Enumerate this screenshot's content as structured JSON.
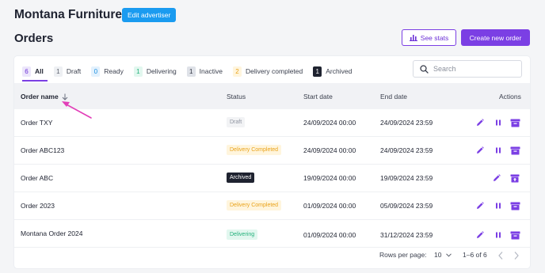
{
  "header": {
    "advertiser": "Montana Furniture",
    "edit_advertiser": "Edit advertiser",
    "page_title": "Orders",
    "see_stats": "See stats",
    "create_new": "Create new order"
  },
  "tabs": [
    {
      "count": "6",
      "label": "All",
      "badge_bg": "#ece6fb",
      "badge_fg": "#6b2fd6"
    },
    {
      "count": "1",
      "label": "Draft",
      "badge_bg": "#eef0f3",
      "badge_fg": "#5b606c"
    },
    {
      "count": "0",
      "label": "Ready",
      "badge_bg": "#e3f1fd",
      "badge_fg": "#1a8fe0"
    },
    {
      "count": "1",
      "label": "Delivering",
      "badge_bg": "#e2f7ef",
      "badge_fg": "#22b07a"
    },
    {
      "count": "1",
      "label": "Inactive",
      "badge_bg": "#dfe2e8",
      "badge_fg": "#2f3340"
    },
    {
      "count": "2",
      "label": "Delivery completed",
      "badge_bg": "#fff5dd",
      "badge_fg": "#e9a21a"
    },
    {
      "count": "1",
      "label": "Archived",
      "badge_bg": "#1f2330",
      "badge_fg": "#ffffff"
    }
  ],
  "search": {
    "placeholder": "Search"
  },
  "columns": {
    "name": "Order name",
    "status": "Status",
    "start": "Start date",
    "end": "End date",
    "actions": "Actions"
  },
  "rows": [
    {
      "name": "Order TXY",
      "status": "Draft",
      "status_kind": "draft",
      "start": "24/09/2024 00:00",
      "end": "24/09/2024 23:59"
    },
    {
      "name": "Order ABC123",
      "status": "Delivery Completed",
      "status_kind": "completed",
      "start": "24/09/2024 00:00",
      "end": "24/09/2024 23:59"
    },
    {
      "name": "Order ABC",
      "status": "Archived",
      "status_kind": "archived",
      "start": "19/09/2024 00:00",
      "end": "19/09/2024 23:59"
    },
    {
      "name": "Order 2023",
      "status": "Delivery Completed",
      "status_kind": "completed",
      "start": "01/09/2024 00:00",
      "end": "05/09/2024 23:59"
    },
    {
      "name": "Montana Order 2024",
      "status": "Delivering",
      "status_kind": "delivering",
      "start": "01/09/2024 00:00",
      "end": "31/12/2024 23:59"
    }
  ],
  "footer": {
    "rows_per_page_label": "Rows per page:",
    "rows_per_page_value": "10",
    "range": "1–6 of 6"
  },
  "colors": {
    "accent": "#7b3fe4",
    "edit_button": "#1a9bf0",
    "annotation_arrow": "#e23fb8"
  }
}
